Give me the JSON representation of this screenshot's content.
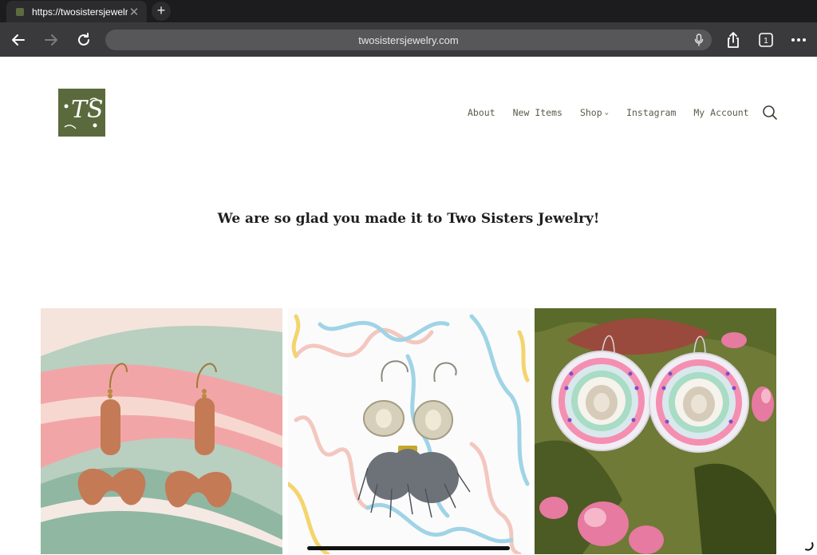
{
  "browser": {
    "tab_title": "https://twosistersjewelry",
    "url": "twosistersjewelry.com",
    "tab_count": "1",
    "icons": [
      "back-icon",
      "forward-icon",
      "reload-icon",
      "microphone-icon",
      "share-icon",
      "tabs-icon",
      "more-icon",
      "close-icon",
      "plus-icon"
    ]
  },
  "site": {
    "logo_text": "TS",
    "nav": [
      {
        "label": "About"
      },
      {
        "label": "New Items"
      },
      {
        "label": "Shop"
      },
      {
        "label": "Instagram"
      },
      {
        "label": "My Account"
      }
    ],
    "welcome": "We are so glad you made it to Two Sisters Jewelry!",
    "products": [
      {
        "description": "peach clay drop earrings"
      },
      {
        "description": "grey feather disc earrings"
      },
      {
        "description": "beaded floral round earrings"
      }
    ]
  },
  "colors": {
    "brand_green": "#5b6a3c",
    "nav_text": "#5a5a4a",
    "chrome_dark": "#1c1c1e",
    "chrome_toolbar": "#3a3a3c"
  }
}
